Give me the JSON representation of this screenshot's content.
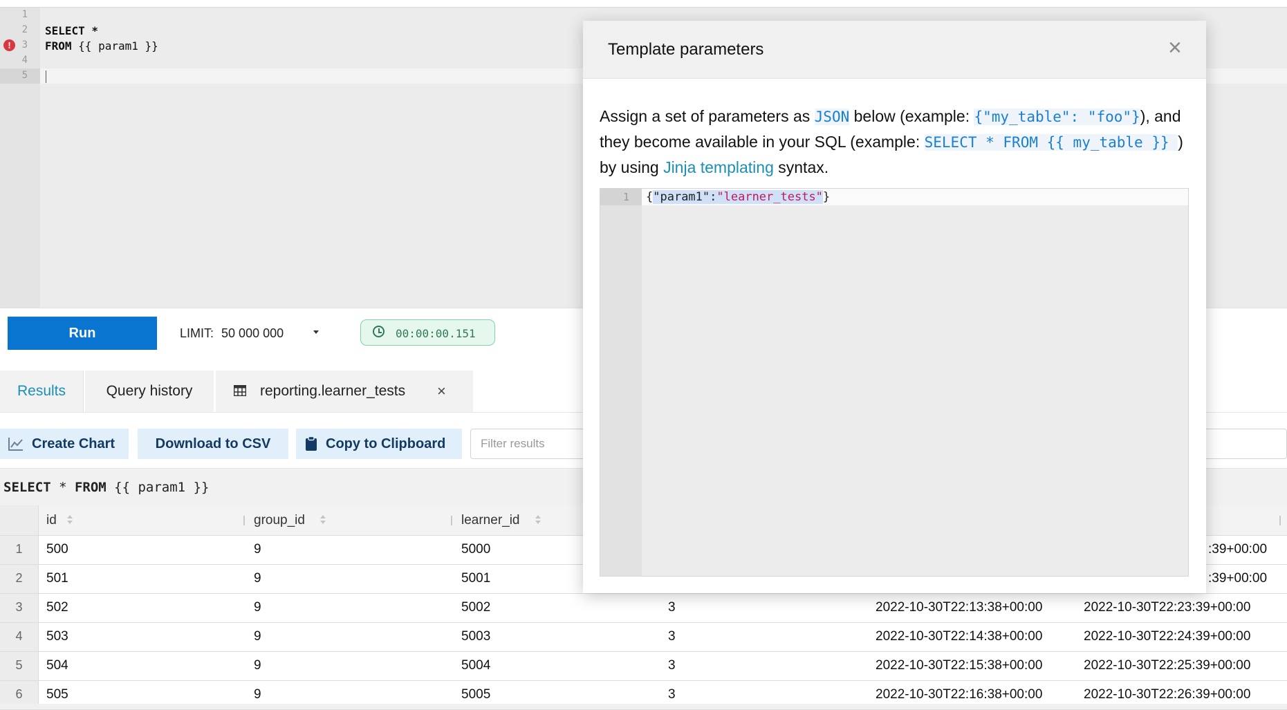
{
  "editor": {
    "line_numbers": [
      "1",
      "2",
      "3",
      "4",
      "5"
    ],
    "line2": "SELECT *",
    "line3_kw": "FROM",
    "line3_rest": " {{ param1 }}",
    "error_marker": "!"
  },
  "toolbar": {
    "run_label": "Run",
    "limit_label": "LIMIT:",
    "limit_value": "50 000 000",
    "timer": "00:00:00.151"
  },
  "tabs": {
    "results": "Results",
    "history": "Query history",
    "table": "reporting.learner_tests",
    "close": "×"
  },
  "actions": {
    "create_chart": "Create Chart",
    "download_csv": "Download to CSV",
    "copy_clipboard": "Copy to Clipboard",
    "filter_placeholder": "Filter results"
  },
  "query_line": {
    "kw1": "SELECT",
    "mid": " * ",
    "kw2": "FROM",
    "rest": " {{ param1 }}"
  },
  "table": {
    "columns": [
      "id",
      "group_id",
      "learner_id"
    ],
    "rows": [
      {
        "n": "1",
        "id": "500",
        "group_id": "9",
        "learner_id": "5000",
        "c4": "",
        "c5": "",
        "c6": ":39+00:00"
      },
      {
        "n": "2",
        "id": "501",
        "group_id": "9",
        "learner_id": "5001",
        "c4": "",
        "c5": "",
        "c6": ":39+00:00"
      },
      {
        "n": "3",
        "id": "502",
        "group_id": "9",
        "learner_id": "5002",
        "c4": "3",
        "c5": "2022-10-30T22:13:38+00:00",
        "c6": "2022-10-30T22:23:39+00:00"
      },
      {
        "n": "4",
        "id": "503",
        "group_id": "9",
        "learner_id": "5003",
        "c4": "3",
        "c5": "2022-10-30T22:14:38+00:00",
        "c6": "2022-10-30T22:24:39+00:00"
      },
      {
        "n": "5",
        "id": "504",
        "group_id": "9",
        "learner_id": "5004",
        "c4": "3",
        "c5": "2022-10-30T22:15:38+00:00",
        "c6": "2022-10-30T22:25:39+00:00"
      },
      {
        "n": "6",
        "id": "505",
        "group_id": "9",
        "learner_id": "5005",
        "c4": "3",
        "c5": "2022-10-30T22:16:38+00:00",
        "c6": "2022-10-30T22:26:39+00:00"
      }
    ]
  },
  "modal": {
    "title": "Template parameters",
    "close": "×",
    "desc": {
      "t1": "Assign a set of parameters as ",
      "json": "JSON",
      "t2": " below (example: ",
      "ex1": "{\"my_table\": \"foo\"}",
      "t3": "), and they become available in your SQL (example: ",
      "ex2": "SELECT * FROM {{ my_table }} ",
      "t4": ") by using ",
      "link": "Jinja templating",
      "t5": " syntax."
    },
    "json_editor": {
      "line_number": "1",
      "open_brace": "{",
      "key": "\"param1\"",
      "colon": ":",
      "value": "\"learner_tests\"",
      "close_brace": "}"
    }
  },
  "colors": {
    "run_button": "#0a74d1",
    "tab_active": "#1a8fb5",
    "action_bg": "#e1effb",
    "timer_bg": "#e6f8ee"
  }
}
